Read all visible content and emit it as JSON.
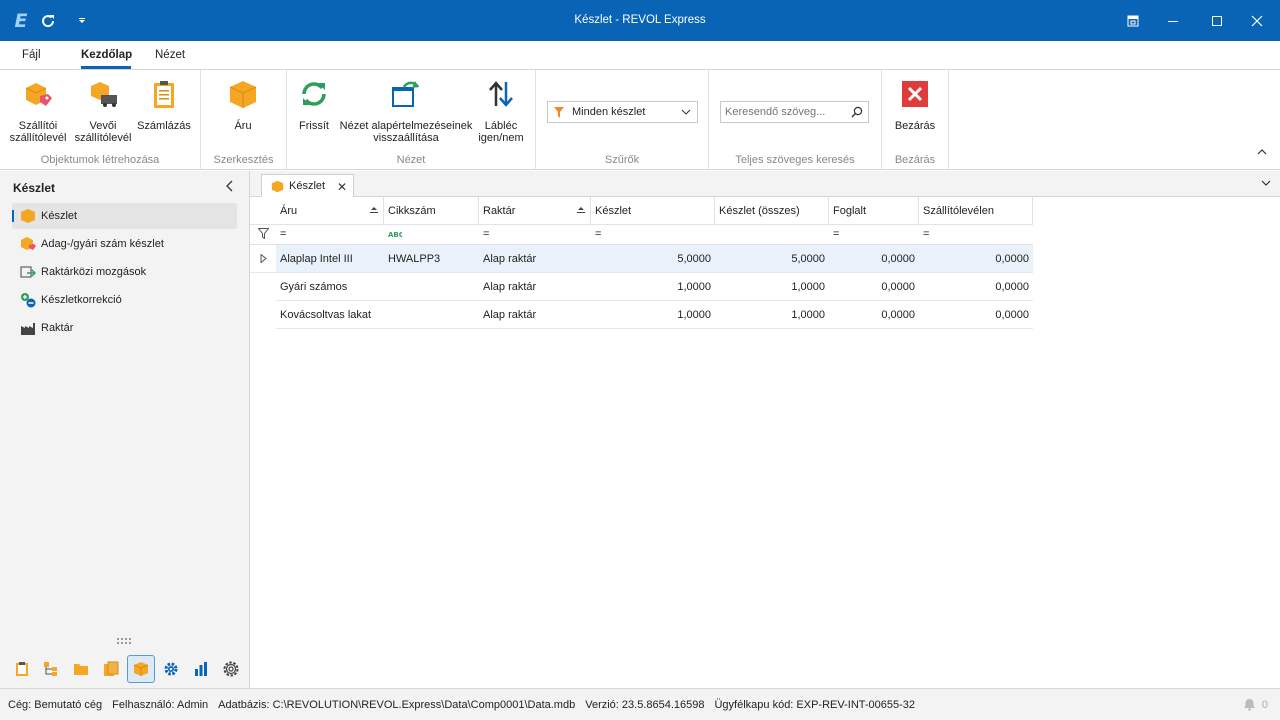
{
  "window": {
    "title": "Készlet - REVOL Express",
    "logo": "E"
  },
  "menu": {
    "tabs": [
      {
        "label": "Fájl"
      },
      {
        "label": "Kezdőlap"
      },
      {
        "label": "Nézet"
      }
    ],
    "active": "Kezdőlap"
  },
  "ribbon": {
    "groups": {
      "objektumok": "Objektumok létrehozása",
      "szerkesztes": "Szerkesztés",
      "nezet": "Nézet",
      "szurok": "Szűrők",
      "kereses": "Teljes szöveges keresés",
      "bezaras": "Bezárás"
    },
    "buttons": {
      "szallitoi_1": "Szállítói",
      "szallitoi_2": "szállítólevél",
      "vevoi_1": "Vevői",
      "vevoi_2": "szállítólevél",
      "szamlazas": "Számlázás",
      "aru": "Áru",
      "frissit": "Frissít",
      "nezet_reset_1": "Nézet alapértelmezéseinek",
      "nezet_reset_2": "visszaállítása",
      "lablec_1": "Lábléc",
      "lablec_2": "igen/nem",
      "bezaras": "Bezárás"
    },
    "filter_value": "Minden készlet",
    "search_placeholder": "Keresendő szöveg..."
  },
  "sidebar": {
    "title": "Készlet",
    "items": [
      {
        "label": "Készlet"
      },
      {
        "label": "Adag-/gyári szám készlet"
      },
      {
        "label": "Raktárközi mozgások"
      },
      {
        "label": "Készletkorrekció"
      },
      {
        "label": "Raktár"
      }
    ]
  },
  "document_tab": {
    "label": "Készlet"
  },
  "table": {
    "columns": [
      "Áru",
      "Cikkszám",
      "Raktár",
      "Készlet",
      "Készlet (összes)",
      "Foglalt",
      "Szállítólevélen"
    ],
    "filter_symbol": "=",
    "rows": [
      [
        "Alaplap Intel III",
        "HWALPP3",
        "Alap raktár",
        "5,0000",
        "5,0000",
        "0,0000",
        "0,0000"
      ],
      [
        "Gyári számos",
        "",
        "Alap raktár",
        "1,0000",
        "1,0000",
        "0,0000",
        "0,0000"
      ],
      [
        "Kovácsoltvas lakat",
        "",
        "Alap raktár",
        "1,0000",
        "1,0000",
        "0,0000",
        "0,0000"
      ]
    ]
  },
  "status": {
    "ceg": "Cég: Bemutató cég",
    "felhasznalo": "Felhasználó: Admin",
    "adatbazis": "Adatbázis: C:\\REVOLUTION\\REVOL.Express\\Data\\Comp0001\\Data.mdb",
    "verzio": "Verzió: 23.5.8654.16598",
    "ugyfelkapu": "Ügyfélkapu kód: EXP-REV-INT-00655-32",
    "notifications": "0"
  },
  "colors": {
    "accent": "#0a64b5",
    "orange": "#f5a623",
    "red": "#e03c3c",
    "green": "#2e9e5b"
  }
}
